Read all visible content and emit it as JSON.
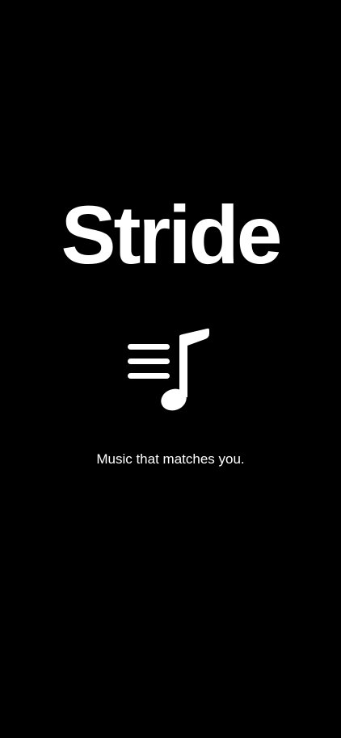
{
  "app": {
    "title": "Stride",
    "tagline": "Music that matches you.",
    "logo_icon": "music-note-list-icon"
  },
  "colors": {
    "background": "#000000",
    "foreground": "#ffffff"
  }
}
